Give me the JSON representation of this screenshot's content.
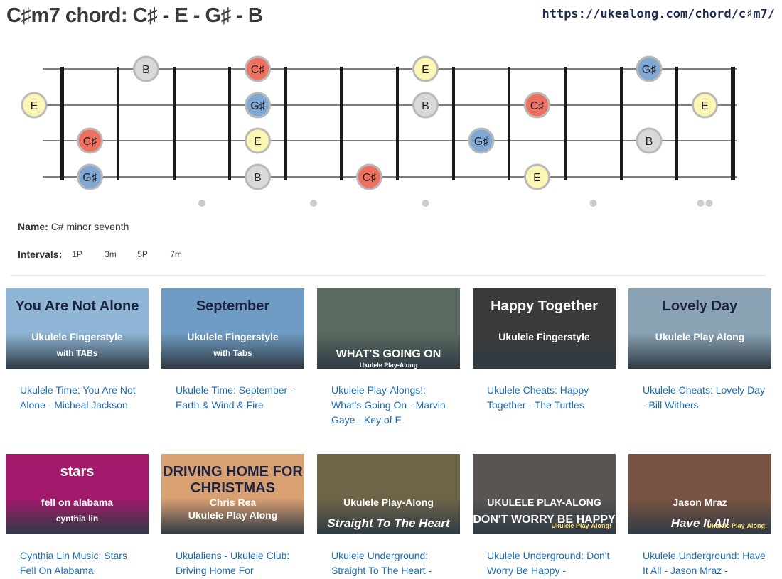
{
  "header": {
    "title": "C♯m7 chord: C♯ - E - G♯ - B",
    "url": "https://ukealong.com/chord/c♯m7/"
  },
  "fretboard": {
    "notes": [
      {
        "string": 1,
        "fret": 2,
        "label": "B",
        "tone": "fifth"
      },
      {
        "string": 1,
        "fret": 4,
        "label": "C♯",
        "tone": "root"
      },
      {
        "string": 1,
        "fret": 7,
        "label": "E",
        "tone": "third"
      },
      {
        "string": 1,
        "fret": 11,
        "label": "G♯",
        "tone": "seventh"
      },
      {
        "string": 2,
        "fret": 0,
        "label": "E",
        "tone": "third"
      },
      {
        "string": 2,
        "fret": 4,
        "label": "G♯",
        "tone": "seventh"
      },
      {
        "string": 2,
        "fret": 7,
        "label": "B",
        "tone": "fifth"
      },
      {
        "string": 2,
        "fret": 9,
        "label": "C♯",
        "tone": "root"
      },
      {
        "string": 2,
        "fret": 12,
        "label": "E",
        "tone": "third"
      },
      {
        "string": 3,
        "fret": 1,
        "label": "C♯",
        "tone": "root"
      },
      {
        "string": 3,
        "fret": 4,
        "label": "E",
        "tone": "third"
      },
      {
        "string": 3,
        "fret": 8,
        "label": "G♯",
        "tone": "seventh"
      },
      {
        "string": 3,
        "fret": 11,
        "label": "B",
        "tone": "fifth"
      },
      {
        "string": 4,
        "fret": 1,
        "label": "G♯",
        "tone": "seventh"
      },
      {
        "string": 4,
        "fret": 4,
        "label": "B",
        "tone": "fifth"
      },
      {
        "string": 4,
        "fret": 6,
        "label": "C♯",
        "tone": "root"
      },
      {
        "string": 4,
        "fret": 9,
        "label": "E",
        "tone": "third"
      }
    ],
    "markers": [
      3,
      5,
      7,
      10
    ],
    "double_marker": 12,
    "colors": {
      "root": "#f07060",
      "third": "#fbf6b4",
      "fifth": "#d9d9d9",
      "seventh": "#7fa8d4",
      "border": "#b9b9b9",
      "fret": "#1a1a1a",
      "string": "#555555",
      "marker": "#cccccc"
    }
  },
  "info": {
    "name_label": "Name:",
    "name_value": "C# minor seventh",
    "intervals_label": "Intervals:",
    "intervals": [
      "1P",
      "3m",
      "5P",
      "7m"
    ]
  },
  "videos": [
    {
      "title": "Ukulele Time: You Are Not Alone - Micheal Jackson",
      "thumb_text": "You Are Not Alone",
      "thumb_sub": "Ukulele Fingerstyle",
      "thumb_sub2": "with TABs",
      "bg": "#8fb6d6"
    },
    {
      "title": "Ukulele Time: September - Earth & Wind & Fire",
      "thumb_text": "September",
      "thumb_sub": "Ukulele Fingerstyle",
      "thumb_sub2": "with Tabs",
      "bg": "#6f9cc4"
    },
    {
      "title": "Ukulele Play-Alongs!: What's Going On - Marvin Gaye - Key of E",
      "thumb_text": "WHAT'S GOING ON",
      "thumb_sub": "Ukulele Play-Along",
      "thumb_sub2": "",
      "bg": "#5b6a60"
    },
    {
      "title": "Ukulele Cheats: Happy Together - The Turtles",
      "thumb_text": "Happy Together",
      "thumb_sub": "Ukulele Fingerstyle",
      "thumb_sub2": "",
      "bg": "#3d3b3a"
    },
    {
      "title": "Ukulele Cheats: Lovely Day - Bill Withers",
      "thumb_text": "Lovely Day",
      "thumb_sub": "Ukulele Play Along",
      "thumb_sub2": "",
      "bg": "#8aa3b4"
    },
    {
      "title": "Cynthia Lin Music: Stars Fell On Alabama",
      "thumb_text": "stars",
      "thumb_sub": "fell on alabama",
      "thumb_sub2": "cynthia lin",
      "bg": "#a3196b"
    },
    {
      "title": "Ukulaliens - Ukulele Club: Driving Home For",
      "thumb_text": "DRIVING HOME FOR CHRISTMAS",
      "thumb_sub": "Chris Rea",
      "thumb_sub2": "Ukulele Play Along",
      "bg": "#d9a072"
    },
    {
      "title": "Ukulele Underground: Straight To The Heart -",
      "thumb_text": "Straight To The Heart",
      "thumb_sub": "Ukulele Play-Along",
      "thumb_sub2": "",
      "bg": "#6f6448"
    },
    {
      "title": "Ukulele Underground: Don't Worry Be Happy -",
      "thumb_text": "DON'T WORRY BE HAPPY",
      "thumb_sub": "UKULELE PLAY-ALONG",
      "thumb_sub2": "Ukulele Play-Along!",
      "bg": "#5a5552"
    },
    {
      "title": "Ukulele Underground: Have It All - Jason Mraz -",
      "thumb_text": "Have It All",
      "thumb_sub": "Jason Mraz",
      "thumb_sub2": "Ukulele Play-Along!",
      "bg": "#7a5442"
    }
  ]
}
